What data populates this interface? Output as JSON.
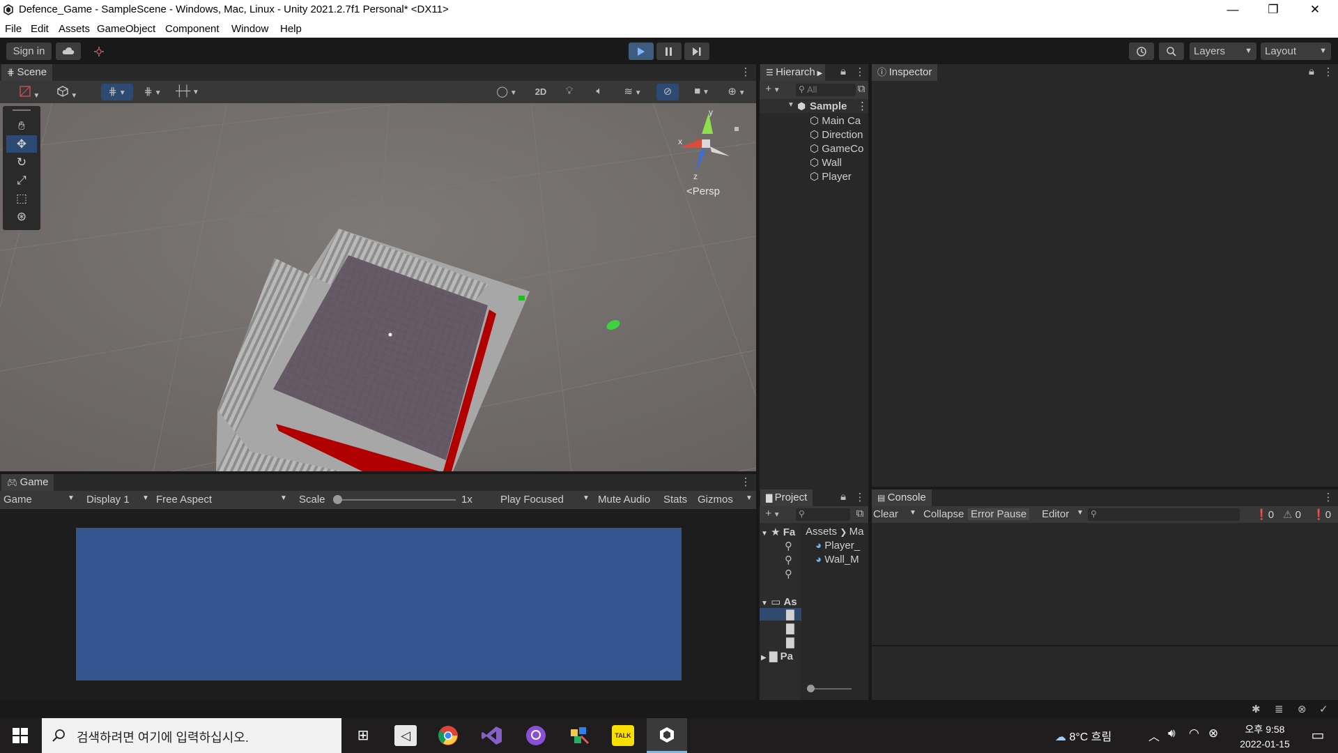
{
  "window": {
    "title": "Defence_Game - SampleScene - Windows, Mac, Linux - Unity 2021.2.7f1 Personal* <DX11>",
    "minimize": "—",
    "maximize": "❐",
    "close": "✕"
  },
  "menu": [
    "File",
    "Edit",
    "Assets",
    "GameObject",
    "Component",
    "Window",
    "Help"
  ],
  "toolbar": {
    "sign_in": "Sign in",
    "layers": "Layers",
    "layout": "Layout"
  },
  "scene": {
    "tab_label": "Scene",
    "btn_2d": "2D",
    "persp": "<Persp",
    "axis_x": "x",
    "axis_y": "y",
    "axis_z": "z"
  },
  "game": {
    "tab_label": "Game",
    "view_select": "Game",
    "display": "Display 1",
    "aspect": "Free Aspect",
    "scale_label": "Scale",
    "scale_value": "1x",
    "scale_fraction": 0.0,
    "play_focused": "Play Focused",
    "mute_audio": "Mute Audio",
    "stats": "Stats",
    "gizmos": "Gizmos",
    "camera_bg": "#34558f"
  },
  "hierarchy": {
    "tab_label": "Hierarch",
    "search_placeholder": "All",
    "scene_name": "Samplе",
    "items": [
      "Main Ca",
      "Direction",
      "GameCo",
      "Wall",
      "Player"
    ]
  },
  "inspector": {
    "tab_label": "Inspector"
  },
  "project": {
    "tab_label": "Project",
    "favorites": "Fa",
    "assets_root": "As",
    "packages": "Pa",
    "breadcrumb_root": "Assets",
    "breadcrumb_child": "Ma",
    "files": [
      "Player_",
      "Wall_M"
    ]
  },
  "console": {
    "tab_label": "Console",
    "clear": "Clear",
    "collapse": "Collapse",
    "error_pause": "Error Pause",
    "editor": "Editor",
    "log_count": "0",
    "warn_count": "0",
    "error_count": "0"
  },
  "taskbar": {
    "search_placeholder": "검색하려면 여기에 입력하십시오.",
    "weather": "8°C 흐림",
    "ampm_time": "오후 9:58",
    "date": "2022-01-15"
  }
}
